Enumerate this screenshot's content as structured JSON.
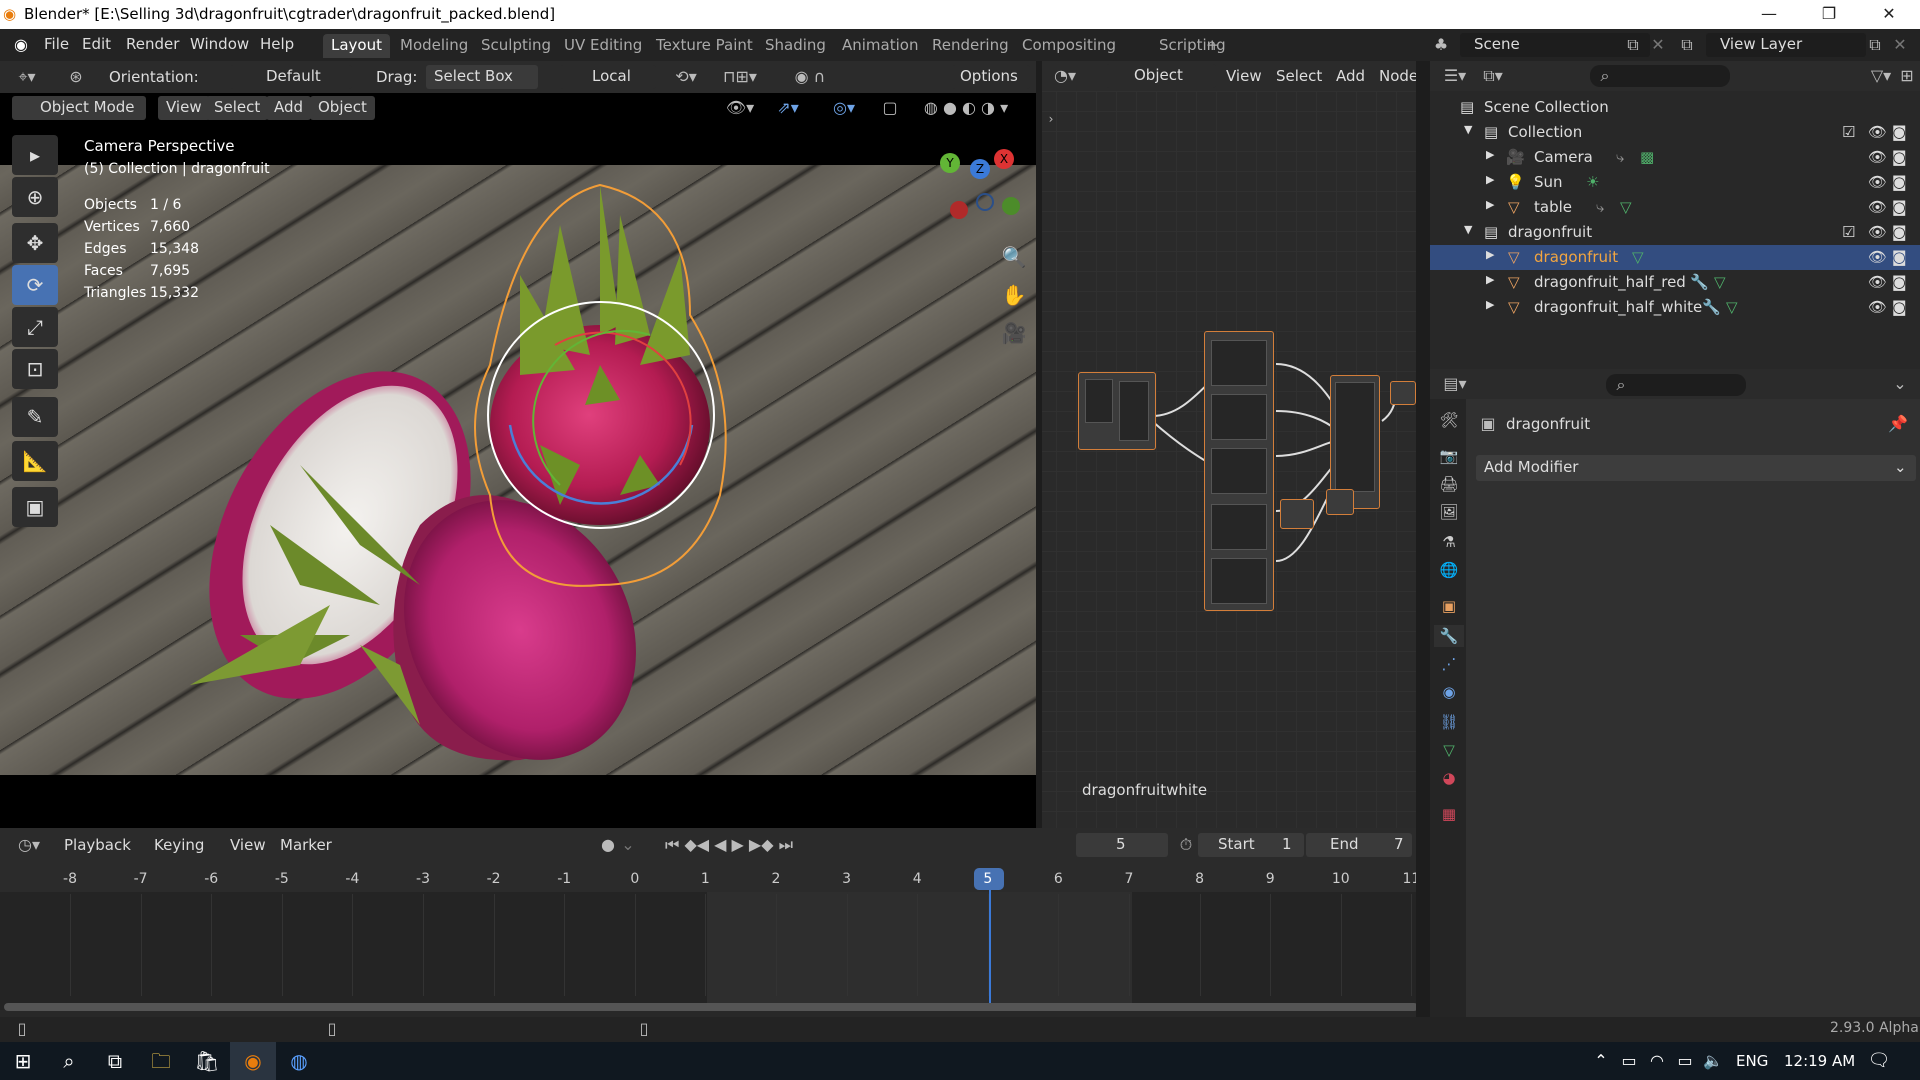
{
  "window": {
    "title": "Blender* [E:\\Selling 3d\\dragonfruit\\cgtrader\\dragonfruit_packed.blend]",
    "minimize": "—",
    "maximize": "❐",
    "close": "✕"
  },
  "topbar": {
    "menus": [
      "File",
      "Edit",
      "Render",
      "Window",
      "Help"
    ],
    "workspaces": [
      "Layout",
      "Modeling",
      "Sculpting",
      "UV Editing",
      "Texture Paint",
      "Shading",
      "Animation",
      "Rendering",
      "Compositing",
      "Scripting"
    ],
    "add_workspace": "+",
    "scene_label": "Scene",
    "view_layer_label": "View Layer"
  },
  "viewport_header": {
    "orientation_label": "Orientation:",
    "orientation_value": "Default",
    "drag_label": "Drag:",
    "drag_value": "Select Box",
    "pivot_value": "Local",
    "options_label": "Options",
    "mode": "Object Mode",
    "menus": [
      "View",
      "Select",
      "Add",
      "Object"
    ]
  },
  "viewport": {
    "camera_title": "Camera Perspective",
    "collection_info": "(5) Collection | dragonfruit",
    "stats": [
      {
        "label": "Objects",
        "value": "1 / 6"
      },
      {
        "label": "Vertices",
        "value": "7,660"
      },
      {
        "label": "Edges",
        "value": "15,348"
      },
      {
        "label": "Faces",
        "value": "7,695"
      },
      {
        "label": "Triangles",
        "value": "15,332"
      }
    ],
    "gizmo": {
      "x": "X",
      "y": "Y",
      "z": "Z"
    }
  },
  "node_editor": {
    "header_mode": "Object",
    "menus": [
      "View",
      "Select",
      "Add",
      "Node"
    ],
    "material_name": "dragonfruitwhite"
  },
  "outliner": {
    "rows": [
      {
        "name": "Scene Collection",
        "indent": 0
      },
      {
        "name": "Collection",
        "indent": 1
      },
      {
        "name": "Camera",
        "indent": 2
      },
      {
        "name": "Sun",
        "indent": 2
      },
      {
        "name": "table",
        "indent": 2
      },
      {
        "name": "dragonfruit",
        "indent": 1
      },
      {
        "name": "dragonfruit",
        "indent": 2,
        "selected": true
      },
      {
        "name": "dragonfruit_half_red",
        "indent": 2
      },
      {
        "name": "dragonfruit_half_white",
        "indent": 2
      }
    ]
  },
  "properties": {
    "object_name": "dragonfruit",
    "add_modifier": "Add Modifier"
  },
  "timeline": {
    "menus": [
      "Playback",
      "Keying",
      "View",
      "Marker"
    ],
    "current_frame": "5",
    "start_label": "Start",
    "start_value": "1",
    "end_label": "End",
    "end_value": "7",
    "ticks": [
      "-8",
      "-7",
      "-6",
      "-5",
      "-4",
      "-3",
      "-2",
      "-1",
      "0",
      "1",
      "2",
      "3",
      "4",
      "5",
      "6",
      "7",
      "8",
      "9",
      "10",
      "11"
    ]
  },
  "statusbar": {
    "version": "2.93.0 Alpha"
  },
  "taskbar": {
    "language": "ENG",
    "time": "12:19 AM"
  },
  "colors": {
    "accent_blue": "#4772b3",
    "selection_orange": "#f29d38",
    "frame_marker": "#3b7ad8"
  }
}
